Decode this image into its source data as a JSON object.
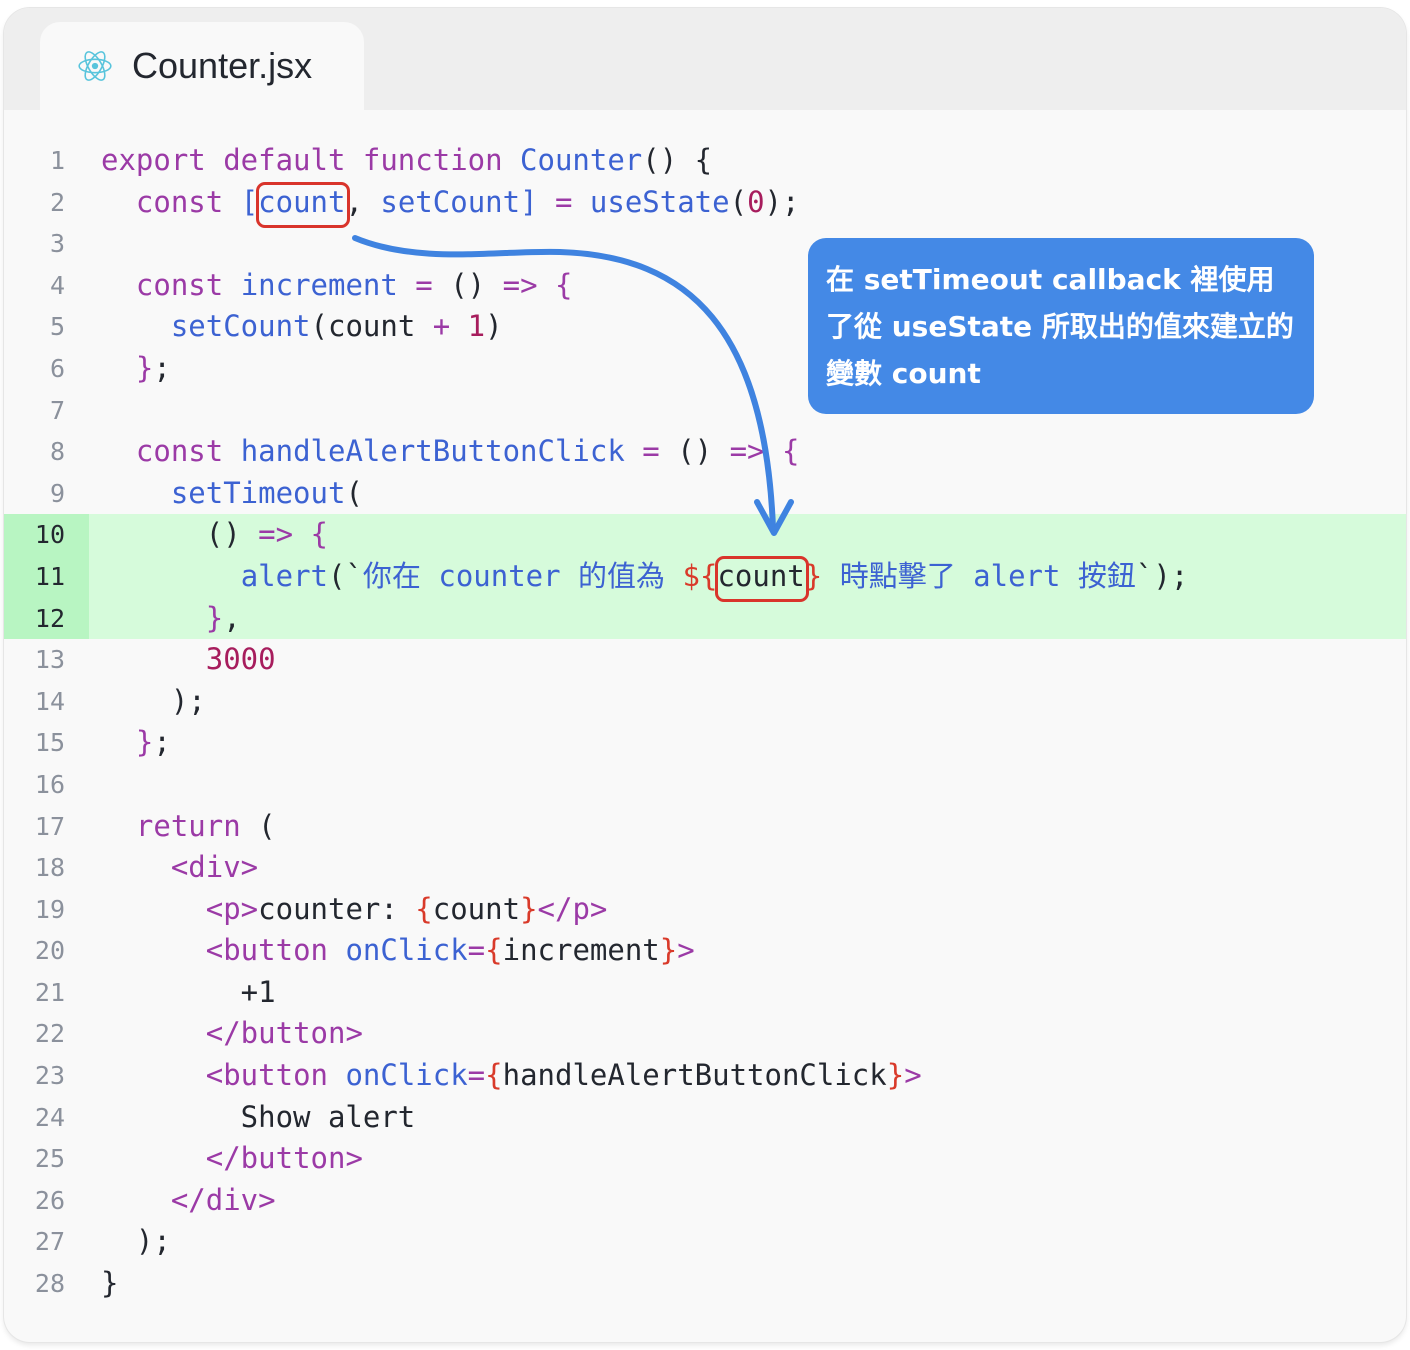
{
  "tab": {
    "filename": "Counter.jsx",
    "icon": "react-icon"
  },
  "callout": {
    "text": "在 setTimeout callback 裡使用了從 useState 所取出的值來建立的變數 count"
  },
  "colors": {
    "keyword": "#9b3aa6",
    "function": "#3c62d2",
    "number": "#a71d5d",
    "interpolation": "#d93a2a",
    "plain": "#23272f",
    "highlight_bg": "#d6fbdb",
    "callout_bg": "#4489e6",
    "box_border": "#d9342b"
  },
  "highlighted_lines": [
    10,
    11,
    12
  ],
  "code_lines": [
    {
      "n": "1",
      "tokens": [
        [
          "k",
          "export default function "
        ],
        [
          "f",
          "Counter"
        ],
        [
          "p",
          "() {"
        ]
      ]
    },
    {
      "n": "2",
      "tokens": [
        [
          "p",
          "  "
        ],
        [
          "k",
          "const "
        ],
        [
          "f",
          "["
        ],
        [
          "f",
          "count"
        ],
        [
          "p",
          ", "
        ],
        [
          "f",
          "setCount]"
        ],
        [
          "k",
          " = "
        ],
        [
          "f",
          "useState"
        ],
        [
          "p",
          "("
        ],
        [
          "n",
          "0"
        ],
        [
          "p",
          ");"
        ]
      ]
    },
    {
      "n": "3",
      "tokens": []
    },
    {
      "n": "4",
      "tokens": [
        [
          "p",
          "  "
        ],
        [
          "k",
          "const "
        ],
        [
          "f",
          "increment"
        ],
        [
          "k",
          " = "
        ],
        [
          "p",
          "() "
        ],
        [
          "k",
          "=> {"
        ]
      ]
    },
    {
      "n": "5",
      "tokens": [
        [
          "p",
          "    "
        ],
        [
          "f",
          "setCount"
        ],
        [
          "p",
          "(count "
        ],
        [
          "k",
          "+ "
        ],
        [
          "n",
          "1"
        ],
        [
          "p",
          ")"
        ]
      ]
    },
    {
      "n": "6",
      "tokens": [
        [
          "p",
          "  "
        ],
        [
          "k",
          "}"
        ],
        [
          "p",
          ";"
        ]
      ]
    },
    {
      "n": "7",
      "tokens": []
    },
    {
      "n": "8",
      "tokens": [
        [
          "p",
          "  "
        ],
        [
          "k",
          "const "
        ],
        [
          "f",
          "handleAlertButtonClick"
        ],
        [
          "k",
          " = "
        ],
        [
          "p",
          "() "
        ],
        [
          "k",
          "=> {"
        ]
      ]
    },
    {
      "n": "9",
      "tokens": [
        [
          "p",
          "    "
        ],
        [
          "f",
          "setTimeout"
        ],
        [
          "p",
          "("
        ]
      ]
    },
    {
      "n": "10",
      "tokens": [
        [
          "p",
          "      () "
        ],
        [
          "k",
          "=> {"
        ]
      ]
    },
    {
      "n": "11",
      "tokens": [
        [
          "p",
          "        "
        ],
        [
          "f",
          "alert"
        ],
        [
          "p",
          "(`"
        ],
        [
          "t",
          "你在 counter 的值為 "
        ],
        [
          "r",
          "${"
        ],
        [
          "p",
          "count"
        ],
        [
          "r",
          "}"
        ],
        [
          "t",
          " 時點擊了 alert 按鈕"
        ],
        [
          "p",
          "`);"
        ]
      ]
    },
    {
      "n": "12",
      "tokens": [
        [
          "p",
          "      "
        ],
        [
          "k",
          "}"
        ],
        [
          "p",
          ","
        ]
      ]
    },
    {
      "n": "13",
      "tokens": [
        [
          "p",
          "      "
        ],
        [
          "n",
          "3000"
        ]
      ]
    },
    {
      "n": "14",
      "tokens": [
        [
          "p",
          "    );"
        ]
      ]
    },
    {
      "n": "15",
      "tokens": [
        [
          "p",
          "  "
        ],
        [
          "k",
          "}"
        ],
        [
          "p",
          ";"
        ]
      ]
    },
    {
      "n": "16",
      "tokens": []
    },
    {
      "n": "17",
      "tokens": [
        [
          "p",
          "  "
        ],
        [
          "k",
          "return "
        ],
        [
          "p",
          "("
        ]
      ]
    },
    {
      "n": "18",
      "tokens": [
        [
          "p",
          "    "
        ],
        [
          "k",
          "<div>"
        ]
      ]
    },
    {
      "n": "19",
      "tokens": [
        [
          "p",
          "      "
        ],
        [
          "k",
          "<p>"
        ],
        [
          "p",
          "counter: "
        ],
        [
          "r",
          "{"
        ],
        [
          "p",
          "count"
        ],
        [
          "r",
          "}"
        ],
        [
          "k",
          "</p>"
        ]
      ]
    },
    {
      "n": "20",
      "tokens": [
        [
          "p",
          "      "
        ],
        [
          "k",
          "<button "
        ],
        [
          "f",
          "onClick"
        ],
        [
          "k",
          "="
        ],
        [
          "r",
          "{"
        ],
        [
          "p",
          "increment"
        ],
        [
          "r",
          "}"
        ],
        [
          "k",
          ">"
        ]
      ]
    },
    {
      "n": "21",
      "tokens": [
        [
          "p",
          "        +1"
        ]
      ]
    },
    {
      "n": "22",
      "tokens": [
        [
          "p",
          "      "
        ],
        [
          "k",
          "</button>"
        ]
      ]
    },
    {
      "n": "23",
      "tokens": [
        [
          "p",
          "      "
        ],
        [
          "k",
          "<button "
        ],
        [
          "f",
          "onClick"
        ],
        [
          "k",
          "="
        ],
        [
          "r",
          "{"
        ],
        [
          "p",
          "handleAlertButtonClick"
        ],
        [
          "r",
          "}"
        ],
        [
          "k",
          ">"
        ]
      ]
    },
    {
      "n": "24",
      "tokens": [
        [
          "p",
          "        Show alert"
        ]
      ]
    },
    {
      "n": "25",
      "tokens": [
        [
          "p",
          "      "
        ],
        [
          "k",
          "</button>"
        ]
      ]
    },
    {
      "n": "26",
      "tokens": [
        [
          "p",
          "    "
        ],
        [
          "k",
          "</div>"
        ]
      ]
    },
    {
      "n": "27",
      "tokens": [
        [
          "p",
          "  );"
        ]
      ]
    },
    {
      "n": "28",
      "tokens": [
        [
          "p",
          "}"
        ]
      ]
    }
  ]
}
